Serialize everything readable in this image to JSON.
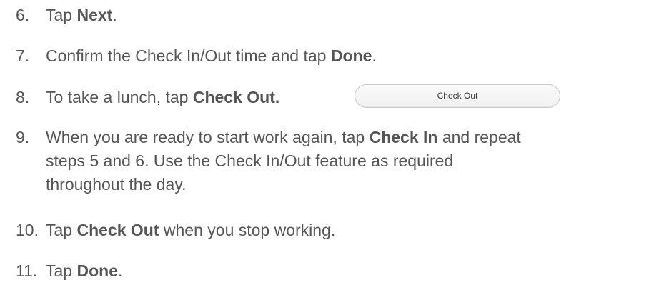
{
  "steps": [
    {
      "num": "6.",
      "pre": "Tap ",
      "bold": "Next",
      "post": "."
    },
    {
      "num": "7.",
      "pre": "Confirm the Check In/Out time and tap ",
      "bold": "Done",
      "post": "."
    },
    {
      "num": "8.",
      "pre": "To take a lunch, tap ",
      "bold": "Check Out.",
      "post": ""
    },
    {
      "num": "9.",
      "line1_pre": "When you are ready to start work again, tap ",
      "line1_bold": "Check In",
      "line1_post": " and repeat",
      "line2": "steps 5 and 6. Use the Check In/Out feature as required",
      "line3": "throughout the day."
    },
    {
      "num": "10.",
      "pre": "Tap ",
      "bold": "Check Out",
      "post": " when you stop working."
    },
    {
      "num": "11.",
      "pre": "Tap ",
      "bold": "Done",
      "post": "."
    }
  ],
  "checkout_button": {
    "label": "Check Out"
  }
}
